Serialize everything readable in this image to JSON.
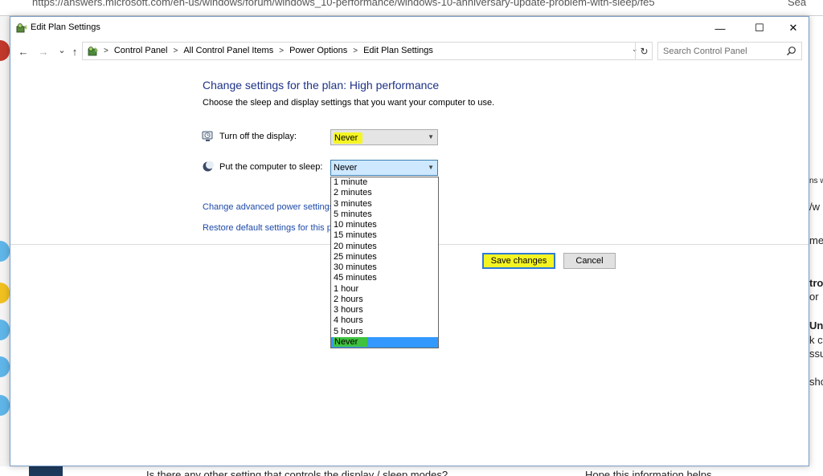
{
  "background": {
    "url_text": "https://answers.microsoft.com/en-us/windows/forum/windows_10-performance/windows-10-anniversary-update-problem-with-sleep/fe5",
    "search_text": "Sea",
    "right_fragments": [
      "ns w",
      "/w",
      "me",
      "tro",
      "or",
      "Un",
      "k c",
      "ssu",
      "sho"
    ],
    "bottom_left_text": "Is there any other setting that controls the display / sleep modes?",
    "bottom_right_text": "Hope this information helps."
  },
  "window": {
    "title": "Edit Plan Settings",
    "minimize_glyph": "—",
    "maximize_glyph": "☐",
    "close_glyph": "✕"
  },
  "nav": {
    "back_glyph": "←",
    "forward_glyph": "→",
    "recent_glyph": "⌄",
    "up_glyph": "↑",
    "breadcrumbs": [
      "Control Panel",
      "All Control Panel Items",
      "Power Options",
      "Edit Plan Settings"
    ],
    "separator": ">",
    "dropdown_glyph": "⌄",
    "refresh_glyph": "↻",
    "search_placeholder": "Search Control Panel"
  },
  "content": {
    "heading": "Change settings for the plan: High performance",
    "subheading": "Choose the sleep and display settings that you want your computer to use.",
    "display_label": "Turn off the display:",
    "display_value": "Never",
    "sleep_label": "Put the computer to sleep:",
    "sleep_value": "Never",
    "advanced_link": "Change advanced power settings",
    "restore_link": "Restore default settings for this pla",
    "save_button": "Save changes",
    "cancel_button": "Cancel"
  },
  "sleep_options": [
    "1 minute",
    "2 minutes",
    "3 minutes",
    "5 minutes",
    "10 minutes",
    "15 minutes",
    "20 minutes",
    "25 minutes",
    "30 minutes",
    "45 minutes",
    "1 hour",
    "2 hours",
    "3 hours",
    "4 hours",
    "5 hours",
    "Never"
  ],
  "selected_sleep_option": "Never",
  "colors": {
    "heading": "#1e3287",
    "link": "#1e4aa8",
    "highlight": "#f5f524",
    "selected_option": "#3399ff"
  }
}
